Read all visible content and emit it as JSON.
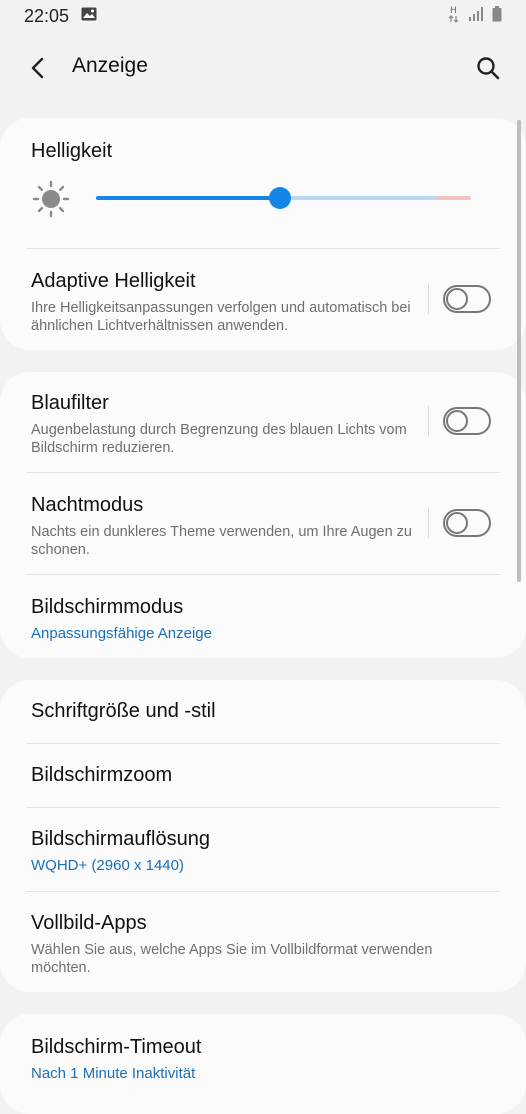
{
  "status_bar": {
    "time": "22:05",
    "left_icons": [
      "image-icon"
    ],
    "right_icons": [
      "data-arrows-icon",
      "signal-icon",
      "battery-icon"
    ]
  },
  "app_bar": {
    "title": "Anzeige",
    "back_icon": "back-arrow-icon",
    "search_icon": "search-icon"
  },
  "brightness": {
    "label": "Helligkeit",
    "icon": "sun-icon",
    "level": 0.49
  },
  "adaptive_brightness": {
    "title": "Adaptive Helligkeit",
    "subtitle": "Ihre Helligkeitsanpassungen verfolgen und automatisch bei ähnlichen Lichtverhältnissen anwenden.",
    "enabled": false
  },
  "blue_light": {
    "title": "Blaufilter",
    "subtitle": "Augenbelastung durch Begrenzung des blauen Lichts vom Bildschirm reduzieren.",
    "enabled": false
  },
  "night_mode": {
    "title": "Nachtmodus",
    "subtitle": "Nachts ein dunkleres Theme verwenden, um Ihre Augen zu schonen.",
    "enabled": false
  },
  "screen_mode": {
    "title": "Bildschirmmodus",
    "value": "Anpassungsfähige Anzeige"
  },
  "font": {
    "title": "Schriftgröße und -stil"
  },
  "zoom": {
    "title": "Bildschirmzoom"
  },
  "resolution": {
    "title": "Bildschirmauflösung",
    "value": "WQHD+ (2960 x 1440)"
  },
  "fullscreen_apps": {
    "title": "Vollbild-Apps",
    "subtitle": "Wählen Sie aus, welche Apps Sie im Vollbildformat verwenden möchten."
  },
  "timeout": {
    "title": "Bildschirm-Timeout",
    "value": "Nach 1 Minute Inaktivität"
  },
  "colors": {
    "accent": "#1585e6",
    "link": "#1a6fb8",
    "background": "#f2f2f2",
    "card": "#fbfbfb"
  }
}
